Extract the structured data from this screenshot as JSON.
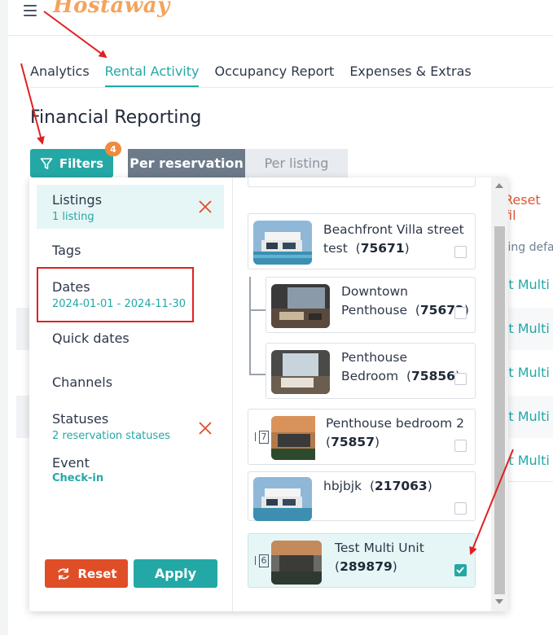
{
  "header": {
    "logo_text": "Hostaway"
  },
  "tabs": [
    {
      "label": "Analytics"
    },
    {
      "label": "Rental Activity"
    },
    {
      "label": "Occupancy Report"
    },
    {
      "label": "Expenses & Extras"
    }
  ],
  "page_title": "Financial Reporting",
  "filters_button": {
    "label": "Filters",
    "badge": "4"
  },
  "segmented": {
    "per_reservation": "Per reservation",
    "per_listing": "Per listing"
  },
  "filter_menu": [
    {
      "label": "Listings",
      "value": "1 listing"
    },
    {
      "label": "Tags",
      "value": ""
    },
    {
      "label": "Dates",
      "value": "2024-01-01 - 2024-11-30"
    },
    {
      "label": "Quick dates",
      "value": ""
    },
    {
      "label": "Channels",
      "value": ""
    },
    {
      "label": "Statuses",
      "value": "2 reservation statuses"
    },
    {
      "label": "Event",
      "value": "Check-in"
    }
  ],
  "actions": {
    "reset": "Reset",
    "apply": "Apply"
  },
  "listings": [
    {
      "name": "Beachfront Villa street test",
      "id": "75671",
      "count": "",
      "checked": false
    },
    {
      "name": "Downtown Penthouse",
      "id": "75672",
      "count": "",
      "checked": false
    },
    {
      "name": "Penthouse Bedroom",
      "id": "75856",
      "count": "",
      "checked": false
    },
    {
      "name": "Penthouse bedroom 2",
      "id": "75857",
      "count": "7",
      "checked": false
    },
    {
      "name": "hbjbjk",
      "id": "217063",
      "count": "",
      "checked": false
    },
    {
      "name": "Test Multi Unit",
      "id": "289879",
      "count": "6",
      "checked": true
    }
  ],
  "background_panel": {
    "reset_link": "Reset fil",
    "column_header": "ting defa",
    "rows": [
      "st Multi",
      "st Multi",
      "st Multi",
      "st Multi",
      "st Multi"
    ]
  },
  "colors": {
    "accent": "#23a8a6",
    "danger": "#e04e28",
    "logo": "#f5a35b",
    "annotation": "#e02020"
  },
  "icons": [
    "hamburger-menu-icon",
    "filter-funnel-icon",
    "close-x-icon",
    "refresh-icon",
    "checkmark-icon",
    "multi-unit-icon"
  ]
}
